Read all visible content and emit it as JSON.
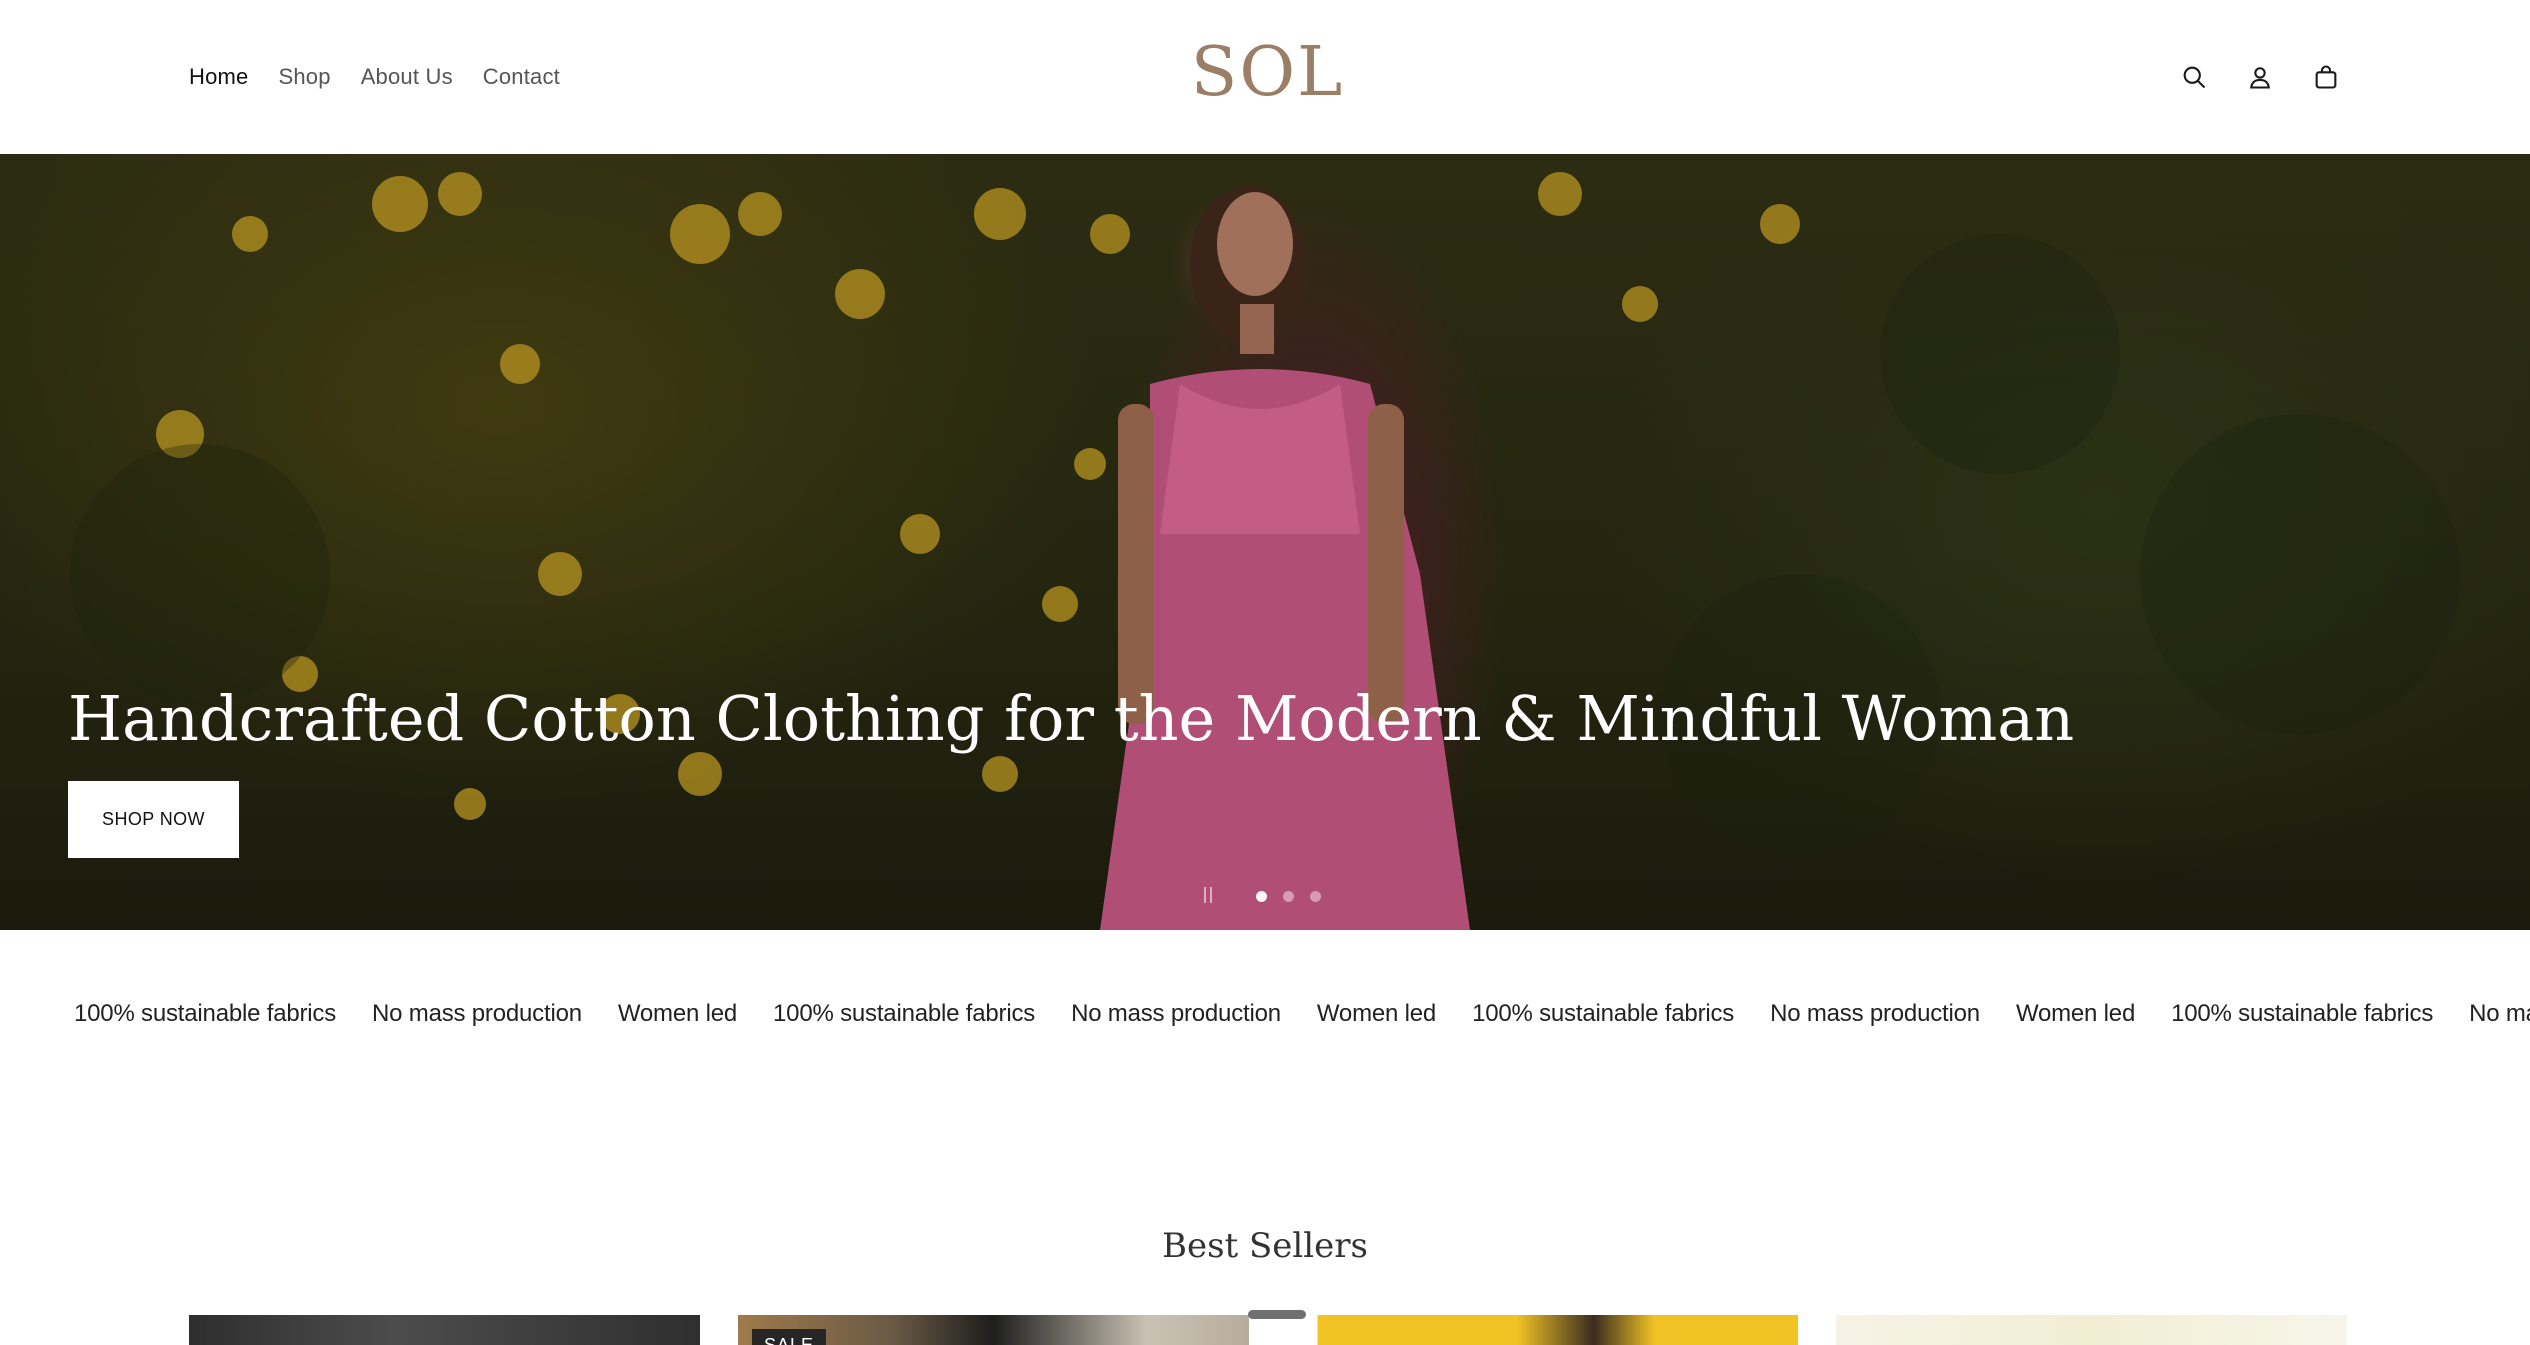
{
  "header": {
    "nav": [
      {
        "label": "Home",
        "active": true
      },
      {
        "label": "Shop",
        "active": false
      },
      {
        "label": "About Us",
        "active": false
      },
      {
        "label": "Contact",
        "active": false
      }
    ],
    "logo_text": "SOL",
    "icons": [
      "search-icon",
      "account-icon",
      "cart-icon"
    ]
  },
  "hero": {
    "title": "Handcrafted Cotton Clothing for the Modern & Mindful Woman",
    "cta_label": "SHOP NOW",
    "slide_count": 3,
    "active_slide": 1
  },
  "marquee": {
    "items": [
      "100% sustainable fabrics",
      "No mass production",
      "Women led",
      "100% sustainable fabrics",
      "No mass production",
      "Women led",
      "100% sustainable fabrics",
      "No mass production",
      "Women led",
      "100% sustainable fabrics",
      "No mass production"
    ]
  },
  "best_sellers": {
    "title": "Best Sellers",
    "badge": "SALE"
  },
  "colors": {
    "logo": "#9a7f66",
    "cta_background": "#ffffff",
    "text": "#1f1f1f"
  }
}
